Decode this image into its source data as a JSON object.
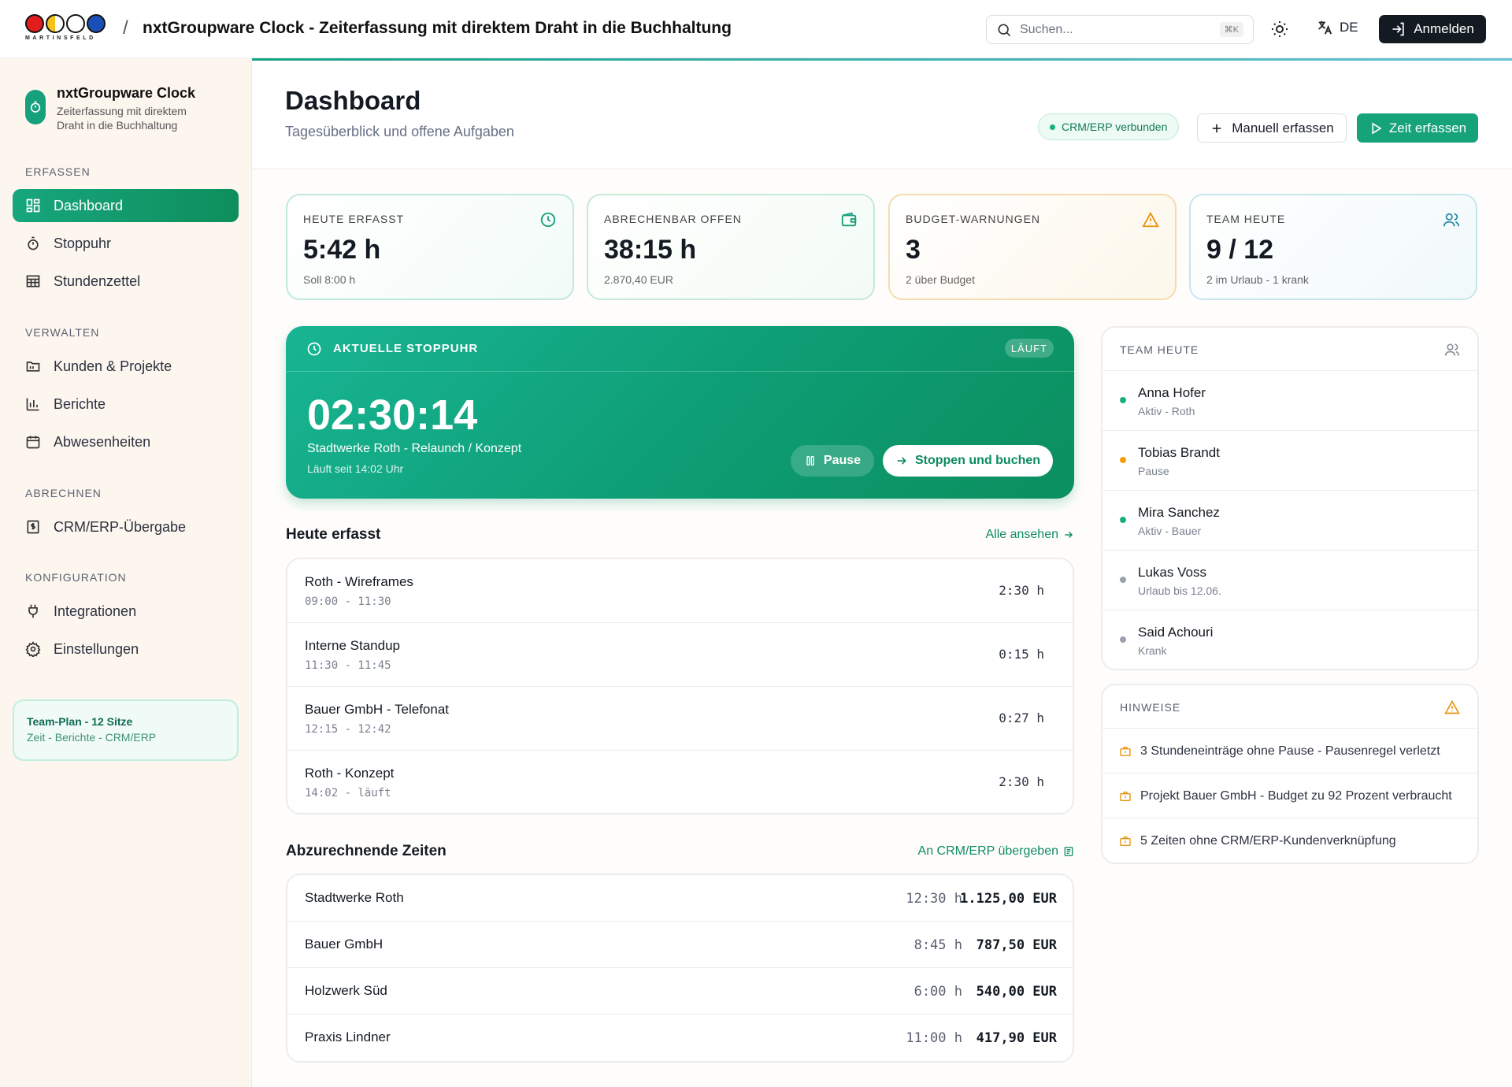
{
  "topbar": {
    "logo_text": "MARTINSFELD",
    "separator": "/",
    "title": "nxtGroupware Clock - Zeiterfassung mit direktem Draht in die Buchhaltung",
    "search_placeholder": "Suchen...",
    "search_shortcut": "⌘K",
    "language": "DE",
    "login_label": "Anmelden",
    "icons": [
      "search-icon",
      "sun-icon",
      "translate-icon",
      "login-icon"
    ]
  },
  "sidebar": {
    "brand_name": "nxtGroupware Clock",
    "brand_sub": "Zeiterfassung mit direktem Draht in die Buchhaltung",
    "sections": [
      {
        "label": "ERFASSEN",
        "items": [
          {
            "label": "Dashboard",
            "icon": "dashboard-icon",
            "active": true
          },
          {
            "label": "Stoppuhr",
            "icon": "stopwatch-icon"
          },
          {
            "label": "Stundenzettel",
            "icon": "timesheet-icon"
          }
        ]
      },
      {
        "label": "VERWALTEN",
        "items": [
          {
            "label": "Kunden & Projekte",
            "icon": "folder-icon"
          },
          {
            "label": "Berichte",
            "icon": "bar-chart-icon"
          },
          {
            "label": "Abwesenheiten",
            "icon": "calendar-icon"
          }
        ]
      },
      {
        "label": "ABRECHNEN",
        "items": [
          {
            "label": "CRM/ERP-Übergabe",
            "icon": "invoice-icon"
          }
        ]
      },
      {
        "label": "KONFIGURATION",
        "items": [
          {
            "label": "Integrationen",
            "icon": "plug-icon"
          },
          {
            "label": "Einstellungen",
            "icon": "gear-icon"
          }
        ]
      }
    ],
    "plan": {
      "title": "Team-Plan - 12 Sitze",
      "sub": "Zeit - Berichte - CRM/ERP"
    }
  },
  "header": {
    "title": "Dashboard",
    "subtitle": "Tagesüberblick und offene Aufgaben",
    "connected_label": "CRM/ERP verbunden",
    "manual_label": "Manuell erfassen",
    "track_label": "Zeit erfassen"
  },
  "stats": [
    {
      "label": "HEUTE ERFASST",
      "value": "5:42 h",
      "sub": "Soll 8:00 h",
      "icon": "clock-icon",
      "color": "#bfe9dd"
    },
    {
      "label": "ABRECHENBAR OFFEN",
      "value": "38:15 h",
      "sub": "2.870,40 EUR",
      "icon": "wallet-icon",
      "color": "#c5ead6"
    },
    {
      "label": "BUDGET-WARNUNGEN",
      "value": "3",
      "sub": "2 über Budget",
      "icon": "warning-icon",
      "color": "#f4dcae"
    },
    {
      "label": "TEAM HEUTE",
      "value": "9 / 12",
      "sub": "2 im Urlaub - 1 krank",
      "icon": "users-icon",
      "color": "#c6e6ee"
    }
  ],
  "stopwatch": {
    "title": "AKTUELLE STOPPUHR",
    "status": "LÄUFT",
    "time": "02:30:14",
    "project": "Stadtwerke Roth - Relaunch / Konzept",
    "since": "Läuft seit 14:02 Uhr",
    "pause_label": "Pause",
    "stop_label": "Stoppen und buchen"
  },
  "today": {
    "title": "Heute erfasst",
    "link": "Alle ansehen",
    "entries": [
      {
        "name": "Roth - Wireframes",
        "range": "09:00 - 11:30",
        "duration": "2:30 h"
      },
      {
        "name": "Interne Standup",
        "range": "11:30 - 11:45",
        "duration": "0:15 h"
      },
      {
        "name": "Bauer GmbH - Telefonat",
        "range": "12:15 - 12:42",
        "duration": "0:27 h"
      },
      {
        "name": "Roth - Konzept",
        "range": "14:02 - läuft",
        "duration": "2:30 h"
      }
    ]
  },
  "billing": {
    "title": "Abzurechnende Zeiten",
    "link": "An CRM/ERP übergeben",
    "rows": [
      {
        "name": "Stadtwerke Roth",
        "hours": "12:30 h",
        "amount": "1.125,00 EUR"
      },
      {
        "name": "Bauer GmbH",
        "hours": "8:45 h",
        "amount": "787,50 EUR"
      },
      {
        "name": "Holzwerk Süd",
        "hours": "6:00 h",
        "amount": "540,00 EUR"
      },
      {
        "name": "Praxis Lindner",
        "hours": "11:00 h",
        "amount": "417,90 EUR"
      }
    ]
  },
  "team_panel": {
    "title": "TEAM HEUTE",
    "members": [
      {
        "name": "Anna Hofer",
        "status": "Aktiv - Roth",
        "color": "#17b07c"
      },
      {
        "name": "Tobias Brandt",
        "status": "Pause",
        "color": "#f59e0b"
      },
      {
        "name": "Mira Sanchez",
        "status": "Aktiv - Bauer",
        "color": "#17b07c"
      },
      {
        "name": "Lukas Voss",
        "status": "Urlaub bis 12.06.",
        "color": "#9aa1ad"
      },
      {
        "name": "Said Achouri",
        "status": "Krank",
        "color": "#9aa1ad"
      }
    ]
  },
  "hints_panel": {
    "title": "HINWEISE",
    "items": [
      "3 Stundeneinträge ohne Pause - Pausenregel verletzt",
      "Projekt Bauer GmbH - Budget zu 92 Prozent verbraucht",
      "5 Zeiten ohne CRM/ERP-Kundenverknüpfung"
    ]
  },
  "colors": {
    "accent": "#17a37a",
    "warning": "#f59e0b",
    "dark": "#141a22"
  }
}
